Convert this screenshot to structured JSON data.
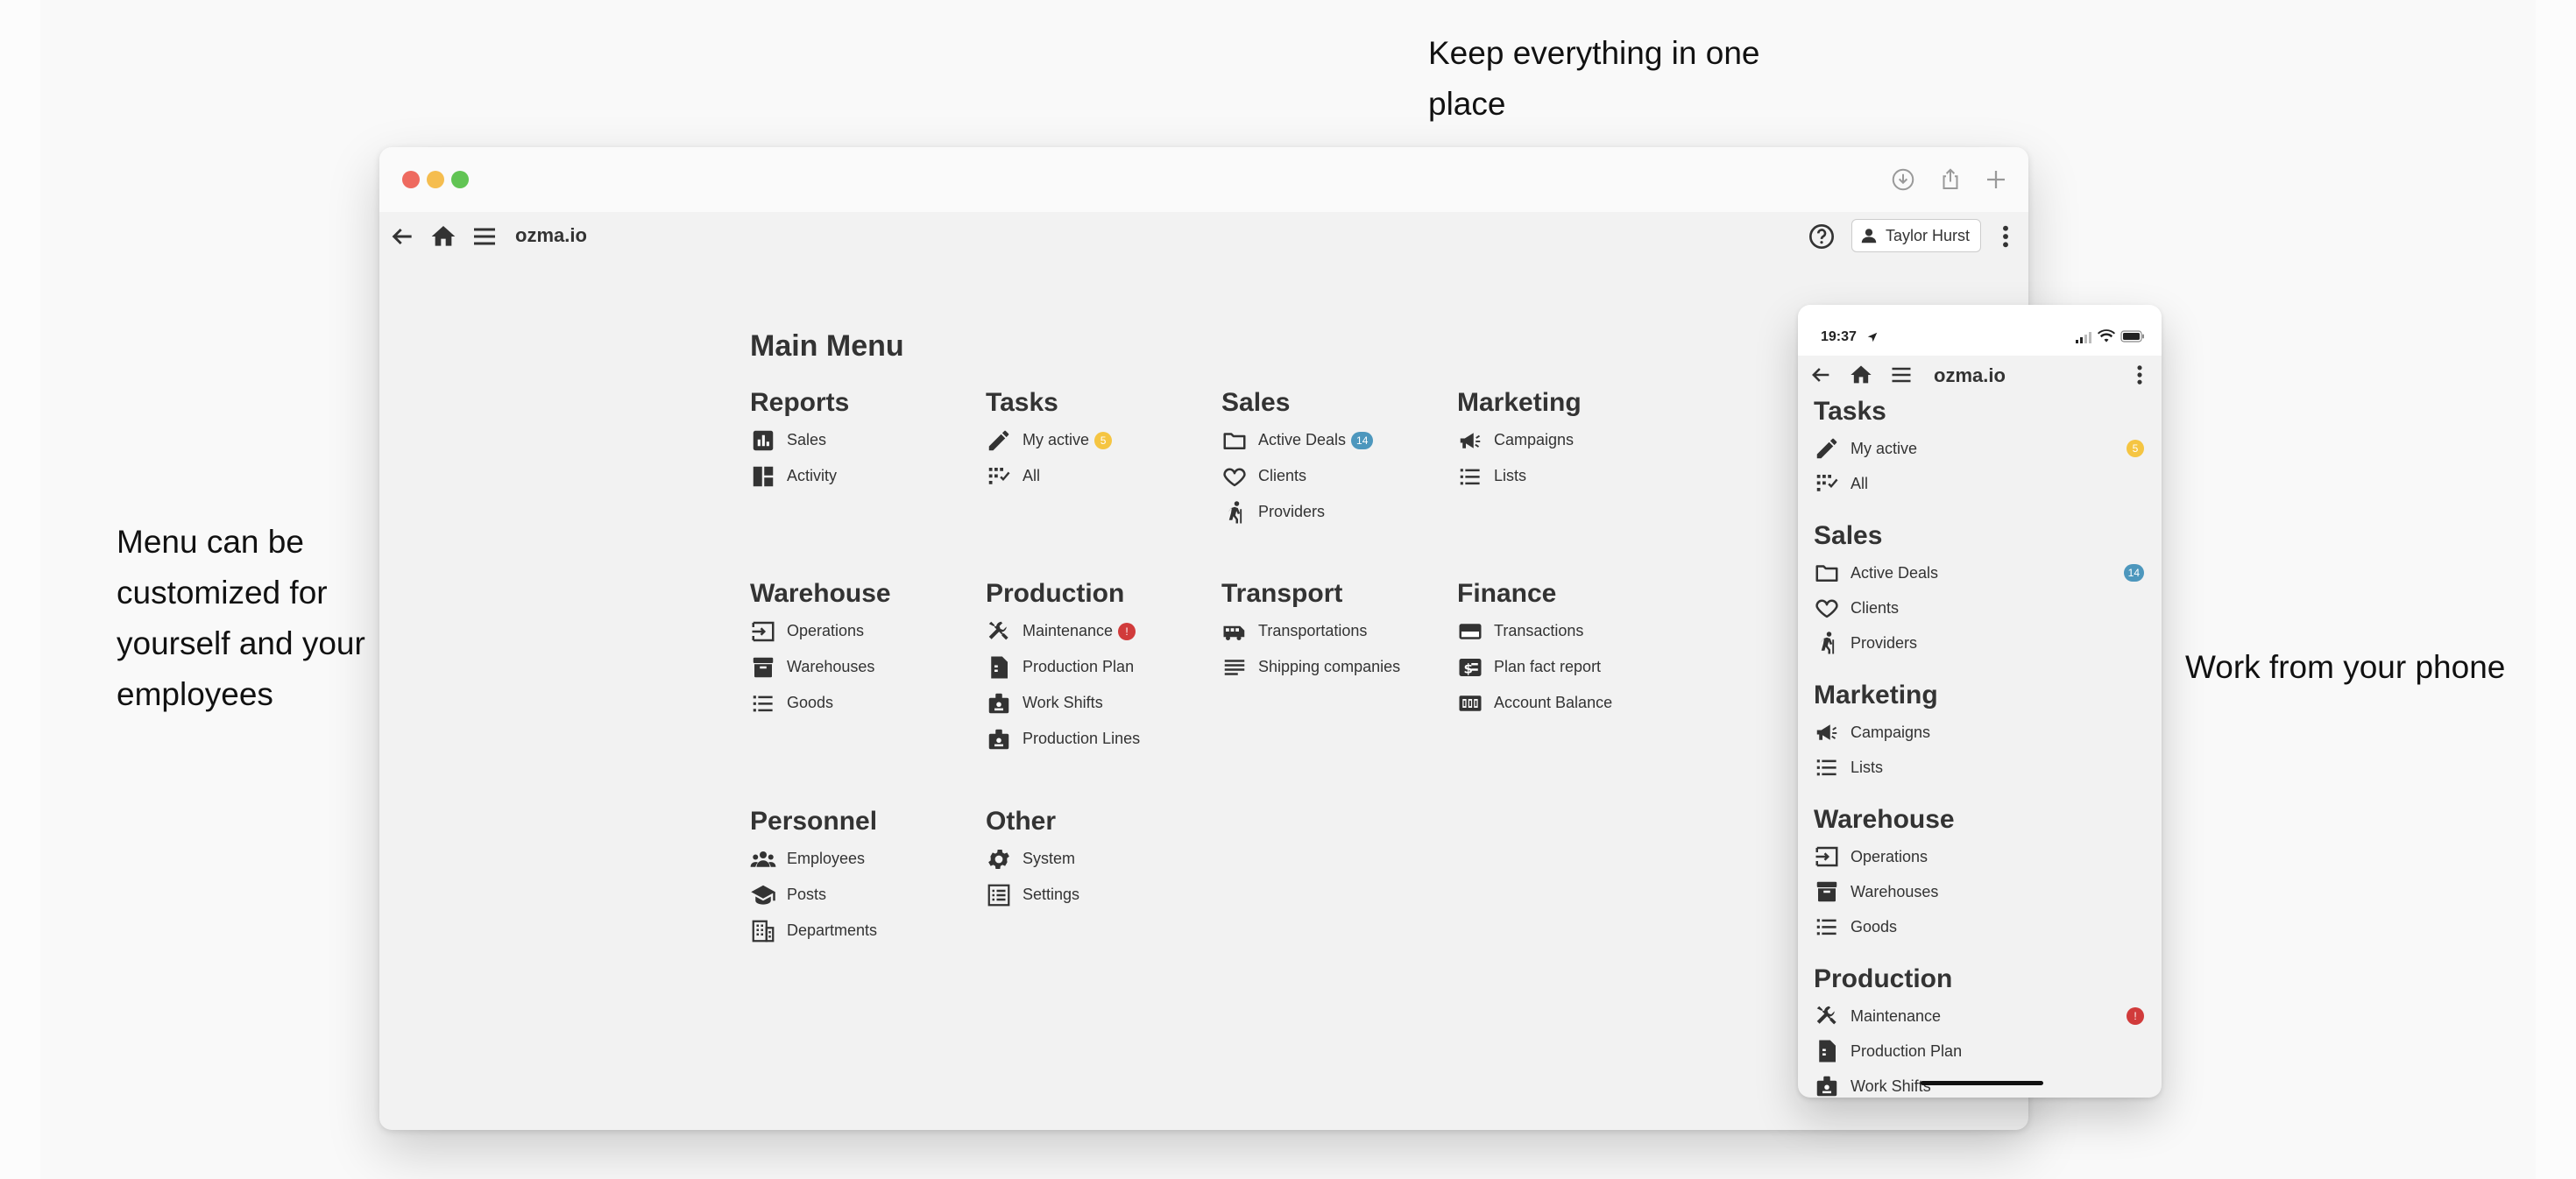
{
  "captions": {
    "top": "Keep everything in one place",
    "left": "Menu can be customized for yourself and your employees",
    "right": "Work from your phone"
  },
  "app": {
    "brand": "ozma.io",
    "user_name": "Taylor Hurst",
    "menu_title": "Main Menu"
  },
  "colors": {
    "badge_yellow": "#f5c542",
    "badge_blue": "#4d97bd",
    "badge_red": "#d13b3b"
  },
  "sections": {
    "reports": {
      "title": "Reports",
      "items": [
        {
          "label": "Sales",
          "icon": "bar-chart-icon"
        },
        {
          "label": "Activity",
          "icon": "dashboard-icon"
        }
      ]
    },
    "tasks": {
      "title": "Tasks",
      "items": [
        {
          "label": "My active",
          "icon": "pencil-icon",
          "badge": "5"
        },
        {
          "label": "All",
          "icon": "checklist-icon"
        }
      ]
    },
    "sales": {
      "title": "Sales",
      "items": [
        {
          "label": "Active Deals",
          "icon": "folder-icon",
          "badge": "14"
        },
        {
          "label": "Clients",
          "icon": "heart-icon"
        },
        {
          "label": "Providers",
          "icon": "person-icon"
        }
      ]
    },
    "marketing": {
      "title": "Marketing",
      "items": [
        {
          "label": "Campaigns",
          "icon": "megaphone-icon"
        },
        {
          "label": "Lists",
          "icon": "list-icon"
        }
      ]
    },
    "warehouse": {
      "title": "Warehouse",
      "items": [
        {
          "label": "Operations",
          "icon": "login-icon"
        },
        {
          "label": "Warehouses",
          "icon": "archive-icon"
        },
        {
          "label": "Goods",
          "icon": "list-icon"
        }
      ]
    },
    "production": {
      "title": "Production",
      "items": [
        {
          "label": "Maintenance",
          "icon": "tools-icon",
          "badge": "!"
        },
        {
          "label": "Production Plan",
          "icon": "document-icon"
        },
        {
          "label": "Work Shifts",
          "icon": "badge-icon"
        },
        {
          "label": "Production Lines",
          "icon": "badge-icon"
        }
      ]
    },
    "transport": {
      "title": "Transport",
      "items": [
        {
          "label": "Transportations",
          "icon": "bus-icon"
        },
        {
          "label": "Shipping companies",
          "icon": "lines-icon"
        }
      ]
    },
    "finance": {
      "title": "Finance",
      "items": [
        {
          "label": "Transactions",
          "icon": "credit-card-icon"
        },
        {
          "label": "Plan fact report",
          "icon": "money-icon"
        },
        {
          "label": "Account Balance",
          "icon": "counter-icon"
        }
      ]
    },
    "personnel": {
      "title": "Personnel",
      "items": [
        {
          "label": "Employees",
          "icon": "group-icon"
        },
        {
          "label": "Posts",
          "icon": "graduation-cap-icon"
        },
        {
          "label": "Departments",
          "icon": "building-icon"
        }
      ]
    },
    "other": {
      "title": "Other",
      "items": [
        {
          "label": "System",
          "icon": "gear-icon"
        },
        {
          "label": "Settings",
          "icon": "form-icon"
        }
      ]
    }
  },
  "phone": {
    "time": "19:37",
    "brand": "ozma.io"
  }
}
